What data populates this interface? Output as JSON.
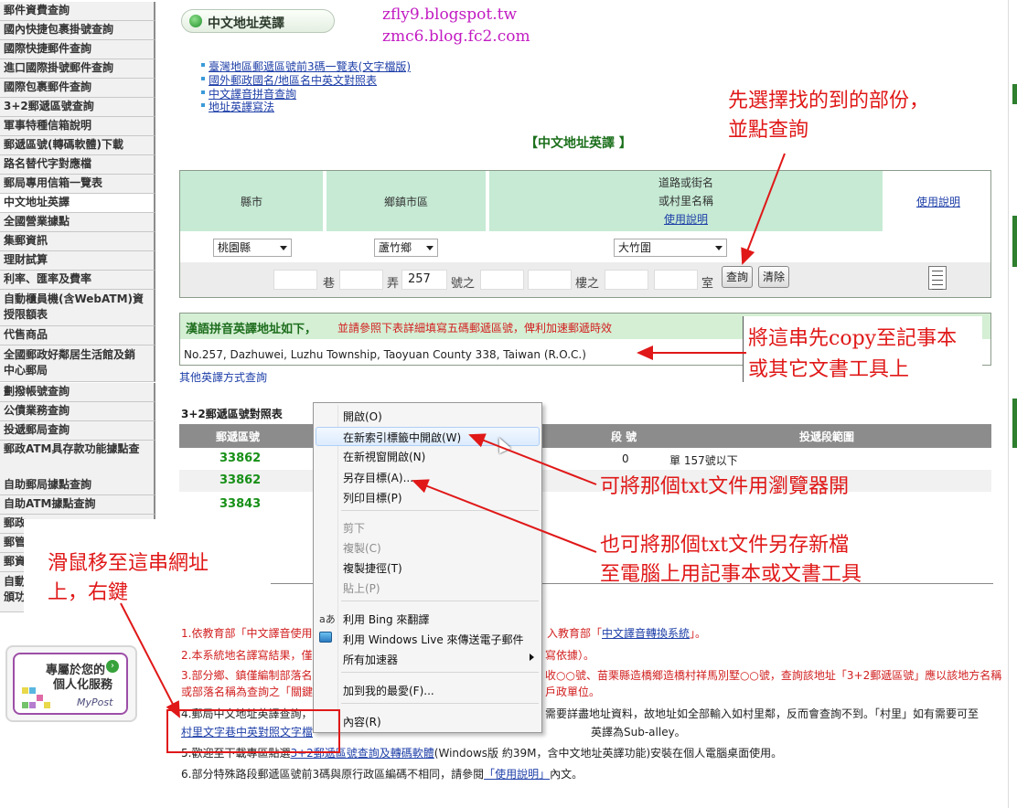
{
  "sidebar": {
    "items": [
      "郵件資費查詢",
      "國內快捷包裹掛號查詢",
      "國際快捷郵件查詢",
      "進口國際掛號郵件查詢",
      "國際包裹郵件查詢",
      "3+2郵遞區號查詢",
      "軍事特種信箱說明",
      "郵遞區號(轉碼軟體)下載",
      "路名替代字對應檔",
      "郵局專用信箱一覽表",
      "中文地址英譯",
      "全國營業據點",
      "集郵資訊",
      "理財試算",
      "利率、匯率及費率",
      "自動櫃員機(含WebATM)資\n授限額表",
      "代售商品",
      "全國郵政好鄰居生活館及銷\n中心郵局",
      "劃撥帳號查詢",
      "公債業務查詢",
      "投遞郵局查詢",
      "郵政ATM具存款功能據點查",
      "自助郵局據點查詢",
      "自助ATM據點查詢",
      "郵政",
      "郵管",
      "郵資",
      "自動\n頒功"
    ],
    "personal_line1": "專屬於您的",
    "personal_line2": "個人化服務",
    "personal_brand": "MyPost"
  },
  "header": {
    "title": "中文地址英譯",
    "blog1": "zfly9.blogspot.tw",
    "blog2": "zmc6.blog.fc2.com"
  },
  "top_links": [
    "臺灣地區郵遞區號前3碼一覽表(文字檔版)",
    "國外郵政國名/地區名中英文對照表",
    "中文譯音拼音查詢",
    "地址英譯寫法"
  ],
  "form": {
    "title": "【中文地址英譯 】",
    "col_city": "縣市",
    "col_town": "鄉鎮市區",
    "col_road_1": "道路或街名",
    "col_road_2": "或村里名稱",
    "col_road_help": "使用說明",
    "col_help": "使用說明",
    "city_value": "桃園縣",
    "town_value": "蘆竹鄉",
    "road_value": "大竹圍",
    "lane_label": "巷",
    "alley_label": "弄",
    "number_value": "257",
    "number_label": "號之",
    "floor_label": "樓之",
    "room_label": "室",
    "query_button": "查詢",
    "clear_button": "清除"
  },
  "result": {
    "title": "漢語拼音英譯地址如下，",
    "note": "並請參照下表詳細填寫五碼郵遞區號，俾利加速郵遞時效",
    "address": "No.257, Dazhuwei, Luzhu Township, Taoyuan County 338, Taiwan (R.O.C.)",
    "other_link": "其他英譯方式查詢"
  },
  "zip_table": {
    "title": "3+2郵遞區號對照表",
    "col_zip": "郵遞區號",
    "col_segment": "段 號",
    "col_range": "投遞段範圍",
    "rows": [
      {
        "zip": "33862",
        "segment": "0",
        "range": "單 157號以下"
      },
      {
        "zip": "33862",
        "segment": "",
        "range": ""
      },
      {
        "zip": "33843",
        "segment": "",
        "range": ""
      }
    ]
  },
  "notes": {
    "n1a": "1.依教育部「中文譯音使用",
    "n1b": "入教育部「",
    "n1_link": "中文譯音轉換系統",
    "n1c": "」。",
    "n2a": "2.本系統地名譯寫結果，僅",
    "n2b": "寫依據）。",
    "n3a": "3.部分鄉、鎮僅編制部落名",
    "n3b": "收○○號、苗栗縣造橋鄉造橋村祥馬別墅○○號，查詢該地址「3+2郵遞區號」應以該地方名稱",
    "n3c": "或部落名稱為查詢之「關鍵",
    "n3d": "戶政單位。",
    "n4a": "4.郵局中文地址英譯查詢，",
    "n4b": "需要詳盡地址資料，故地址如全部輸入如村里鄰，反而會查詢不到。「村里」如有需要可至",
    "n4_link": "村里文字巷中英對照文字檔",
    "n4c": "英譯為Sub-alley。",
    "n5a": "5.歡迎至下載專區點選",
    "n5_link": "3+2郵遞區號查詢及轉碼軟體",
    "n5b": "(Windows版 約39M，含中文地址英譯功能)安裝在個人電腦桌面使用。",
    "n6a": "6.部分特殊路段郵遞區號前3碼與原行政區編碼不相同，請參閱",
    "n6_link": "「使用說明」",
    "n6b": "內文。"
  },
  "context_menu": {
    "items": [
      {
        "label": "開啟(O)",
        "disabled": false
      },
      {
        "label": "在新索引標籤中開啟(W)",
        "disabled": false
      },
      {
        "label": "在新視窗開啟(N)",
        "disabled": false
      },
      {
        "label": "另存目標(A)...",
        "disabled": false
      },
      {
        "label": "列印目標(P)",
        "disabled": false
      },
      {
        "label": "剪下",
        "disabled": true
      },
      {
        "label": "複製(C)",
        "disabled": true
      },
      {
        "label": "複製捷徑(T)",
        "disabled": false
      },
      {
        "label": "貼上(P)",
        "disabled": true
      },
      {
        "label": "利用 Bing 來翻譯",
        "disabled": false
      },
      {
        "label": "利用 Windows Live 來傳送電子郵件",
        "disabled": false
      },
      {
        "label": "所有加速器",
        "disabled": false
      },
      {
        "label": "加到我的最愛(F)...",
        "disabled": false
      },
      {
        "label": "內容(R)",
        "disabled": false
      }
    ]
  },
  "annotations": {
    "a1_line1": "先選擇找的到的部份，",
    "a1_line2": "並點查詢",
    "a2_line1": "將這串先copy至記事本",
    "a2_line2": "或其它文書工具上",
    "a3": "可將那個txt文件用瀏覽器開",
    "a4_line1": "也可將那個txt文件另存新檔",
    "a4_line2": "至電腦上用記事本或文書工具",
    "a5_line1": "滑鼠移至這串網址",
    "a5_line2": "上，右鍵"
  },
  "colors": {
    "annotation_red": "#e01818",
    "header_green": "#c6ead4",
    "zip_green": "#179017",
    "link_blue": "#1e3fa8"
  }
}
